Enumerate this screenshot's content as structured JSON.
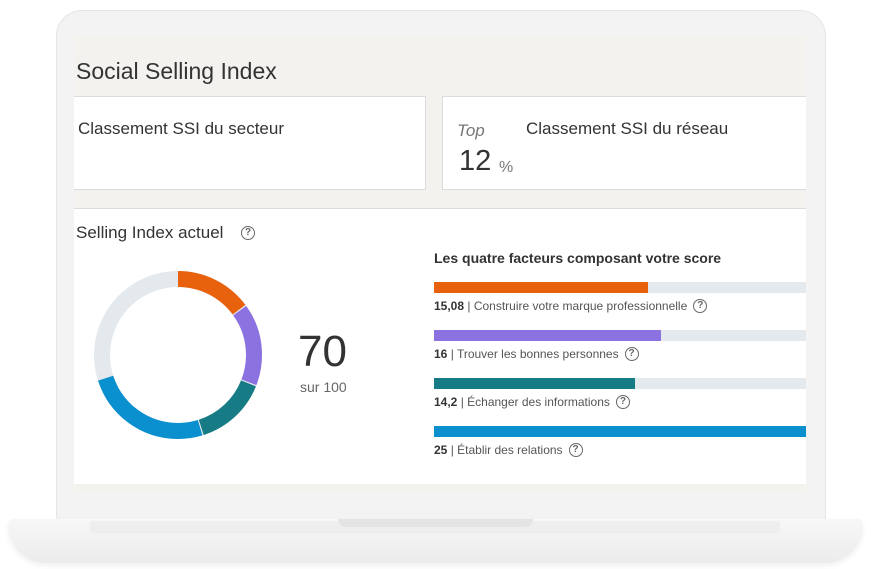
{
  "page": {
    "title": "Social Selling Index"
  },
  "sector_card": {
    "label": "Classement SSI du secteur"
  },
  "network_card": {
    "label": "Classement SSI du réseau",
    "top_label": "Top",
    "value": "12",
    "unit": "%"
  },
  "index": {
    "title": "Selling Index actuel",
    "help_icon": "question-circle-icon",
    "score": "70",
    "score_sub": "sur 100"
  },
  "factors": {
    "title": "Les quatre facteurs composant votre score",
    "max_per_factor": 25,
    "items": [
      {
        "value": "15,08",
        "label": "Construire votre marque professionnelle",
        "score": 15.08,
        "color": "#e8620e"
      },
      {
        "value": "16",
        "label": "Trouver les bonnes personnes",
        "score": 16,
        "color": "#8c72e0"
      },
      {
        "value": "14,2",
        "label": "Échanger des informations",
        "score": 14.2,
        "color": "#177b85"
      },
      {
        "value": "25",
        "label": "Établir des relations",
        "score": 25,
        "color": "#0a8fcf"
      }
    ]
  },
  "donut": {
    "total": 100,
    "track_color": "#e4e9ee"
  }
}
